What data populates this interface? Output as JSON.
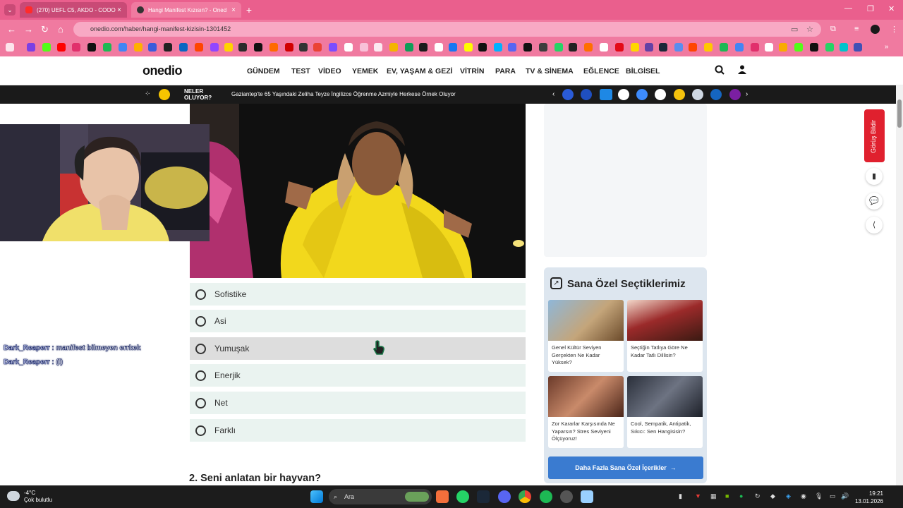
{
  "browser": {
    "tabs": [
      {
        "title": "(270) UEFL C5, AKDO - COOO"
      },
      {
        "title": "Hangi Manifest Kızısın? - Oned"
      }
    ],
    "url": "onedio.com/haber/hangi-manifest-kizisin-1301452"
  },
  "site": {
    "logo": "onedio",
    "nav": [
      "GÜNDEM",
      "TEST",
      "VİDEO",
      "YEMEK",
      "EV, YAŞAM & GEZİ",
      "VİTRİN",
      "PARA",
      "TV & SİNEMA",
      "EĞLENCE",
      "BİLGİSEL"
    ],
    "ticker_label_1": "NELER",
    "ticker_label_2": "OLUYOR?",
    "ticker_text": "Gaziantep'te 65 Yaşındaki Zeliha Teyze İngilizce Öğrenme Azmiyle Herkese Örnek Oluyor"
  },
  "quiz": {
    "options": [
      "Sofistike",
      "Asi",
      "Yumuşak",
      "Enerjik",
      "Net",
      "Farklı"
    ],
    "next_question": "2. Seni anlatan bir hayvan?"
  },
  "chat": [
    {
      "user": "Dark_Reaperr",
      "message": ": manifest bilmeyen errkek"
    },
    {
      "user": "Dark_Reaperr",
      "message": ": (l)"
    }
  ],
  "picks": {
    "title": "Sana Özel Seçtiklerimiz",
    "cards": [
      {
        "title": "Genel Kültür Seviyen Gerçekten Ne Kadar Yüksek?"
      },
      {
        "title": "Seçtiğin Tatlıya Göre Ne Kadar Tatlı Dillisin?"
      },
      {
        "title": "Zor Kararlar Karşısında Ne Yaparsın? Stres Seviyeni Ölçüyoruz!"
      },
      {
        "title": "Cool, Sempatik, Antipatik, Sıkıcı: Sen Hangisisin?"
      }
    ],
    "more_button": "Daha Fazla Sana Özel İçerikler"
  },
  "sidebar": {
    "feedback": "Görüş Bildir"
  },
  "taskbar": {
    "temperature": "-4°C",
    "weather": "Çok bulutlu",
    "search": "Ara",
    "time": "19:21",
    "date": "13.01.2026"
  },
  "colors": {
    "browser_pink": "#f07aa0",
    "option_bg": "#eaf3f0",
    "accent_blue": "#3a7bd0",
    "feedback_red": "#e0202e"
  }
}
